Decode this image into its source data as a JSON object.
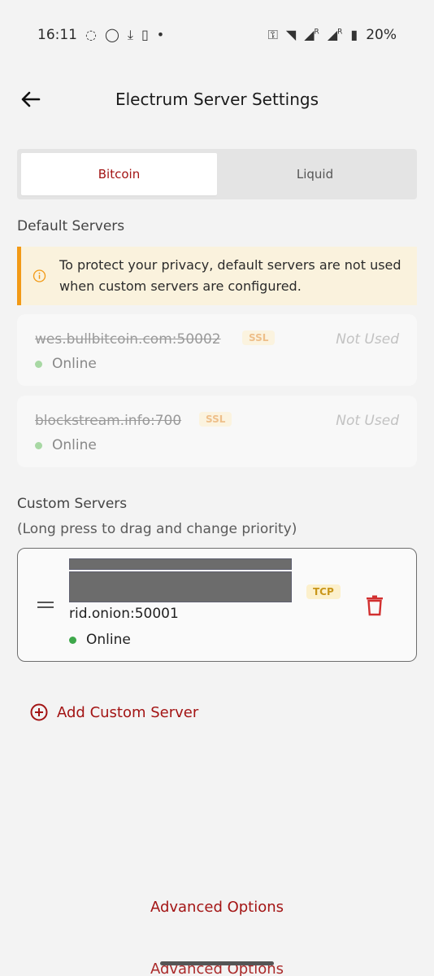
{
  "status_bar": {
    "time": "16:11",
    "battery": "20%",
    "left_icons": [
      "signal-app-icon",
      "whatsapp-icon",
      "download-icon",
      "sim-icon",
      "dot-icon"
    ],
    "right_icons": [
      "key-icon",
      "wifi-icon",
      "signal-r-icon",
      "signal-r-icon",
      "battery-icon"
    ],
    "signal_labels": [
      "R",
      "R"
    ]
  },
  "header": {
    "title": "Electrum Server Settings"
  },
  "tabs": [
    {
      "label": "Bitcoin",
      "active": true
    },
    {
      "label": "Liquid",
      "active": false
    }
  ],
  "default_servers": {
    "label": "Default Servers",
    "notice": "To protect your privacy, default servers are not used when custom servers are configured.",
    "items": [
      {
        "host": "wes.bullbitcoin.com:50002",
        "protocol": "SSL",
        "state": "Not Used",
        "status": "Online"
      },
      {
        "host": "blockstream.info:700",
        "protocol": "SSL",
        "state": "Not Used",
        "status": "Online"
      }
    ]
  },
  "custom_servers": {
    "label": "Custom Servers",
    "hint": "(Long press to drag and change priority)",
    "items": [
      {
        "host": "rid.onion:50001",
        "protocol": "TCP",
        "status": "Online"
      }
    ]
  },
  "actions": {
    "add_custom": "Add Custom Server",
    "advanced": "Advanced Options"
  },
  "colors": {
    "accent": "#a31414",
    "warning": "#f29a16",
    "online_active": "#3ea84b",
    "online_muted": "#a8d8a4"
  }
}
